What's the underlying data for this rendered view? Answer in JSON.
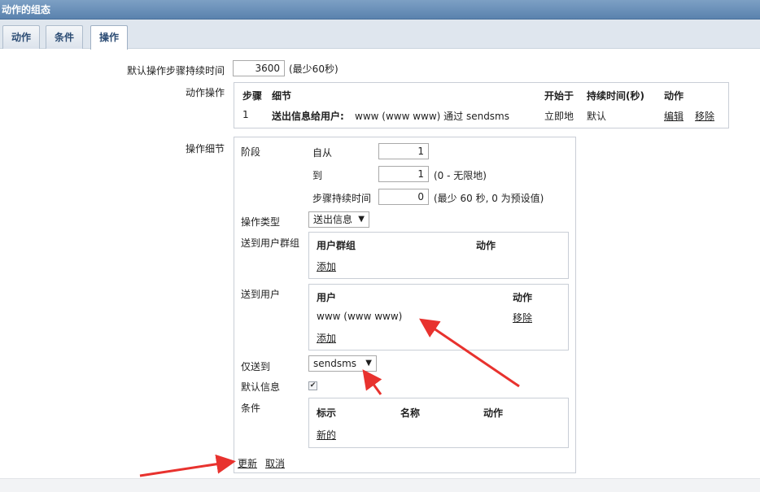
{
  "title": "动作的组态",
  "tabs": [
    "动作",
    "条件",
    "操作"
  ],
  "default_step": {
    "label": "默认操作步骤持续时间",
    "value": "3600",
    "hint": "(最少60秒)"
  },
  "action_ops": {
    "label": "动作操作",
    "headers": [
      "步骤",
      "细节",
      "开始于",
      "持续时间(秒)",
      "动作"
    ],
    "row": {
      "step": "1",
      "detail_bold": "送出信息给用户:",
      "detail_rest": "www (www www) 通过 sendsms",
      "start": "立即地",
      "duration": "默认",
      "edit": "编辑",
      "remove": "移除"
    }
  },
  "op_details": {
    "label": "操作细节",
    "stage_label": "阶段",
    "from_label": "自从",
    "from_value": "1",
    "to_label": "到",
    "to_value": "1",
    "to_hint": "(0 - 无限地)",
    "step_dur_label": "步骤持续时间",
    "step_dur_value": "0",
    "step_dur_hint": "(最少 60 秒, 0 为预设值)",
    "op_type_label": "操作类型",
    "op_type_value": "送出信息",
    "send_groups_label": "送到用户群组",
    "groups_headers": [
      "用户群组",
      "动作"
    ],
    "groups_add": "添加",
    "send_users_label": "送到用户",
    "users_headers": [
      "用户",
      "动作"
    ],
    "user_name": "www (www www)",
    "user_remove": "移除",
    "users_add": "添加",
    "only_send_label": "仅送到",
    "only_send_value": "sendsms",
    "default_msg_label": "默认信息",
    "default_msg_checked": true,
    "conditions_label": "条件",
    "cond_headers": [
      "标示",
      "名称",
      "动作"
    ],
    "cond_new": "新的",
    "update": "更新",
    "cancel": "取消"
  },
  "colors": {
    "titlebar": "#5a82ae",
    "tab_text": "#2c4c74",
    "annotation_arrow": "#e8322e"
  },
  "icons": [
    "dropdown-arrow-icon",
    "checkmark-icon",
    "annotation-arrow-icon"
  ]
}
